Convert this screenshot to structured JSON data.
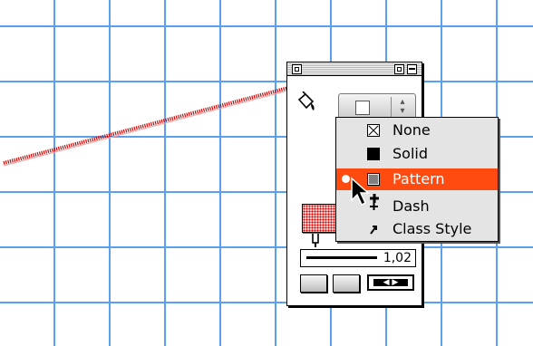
{
  "attribute_palette": {
    "fill_menu": {
      "items": [
        {
          "label": "None",
          "icon": "empty-box-icon"
        },
        {
          "label": "Solid",
          "icon": "solid-box-icon"
        },
        {
          "label": "Pattern",
          "icon": "pattern-box-icon",
          "selected": true
        },
        {
          "label": "Dash",
          "icon": "dash-icon"
        },
        {
          "label": "Class Style",
          "icon": "class-style-icon"
        }
      ]
    },
    "line_weight": {
      "value": "1,02"
    },
    "colors": {
      "grid_line": "#5aa0f0",
      "menu_highlight": "#ff4a10",
      "pattern_red": "#d40000",
      "swatch_pink": "#f6c2c2"
    }
  }
}
